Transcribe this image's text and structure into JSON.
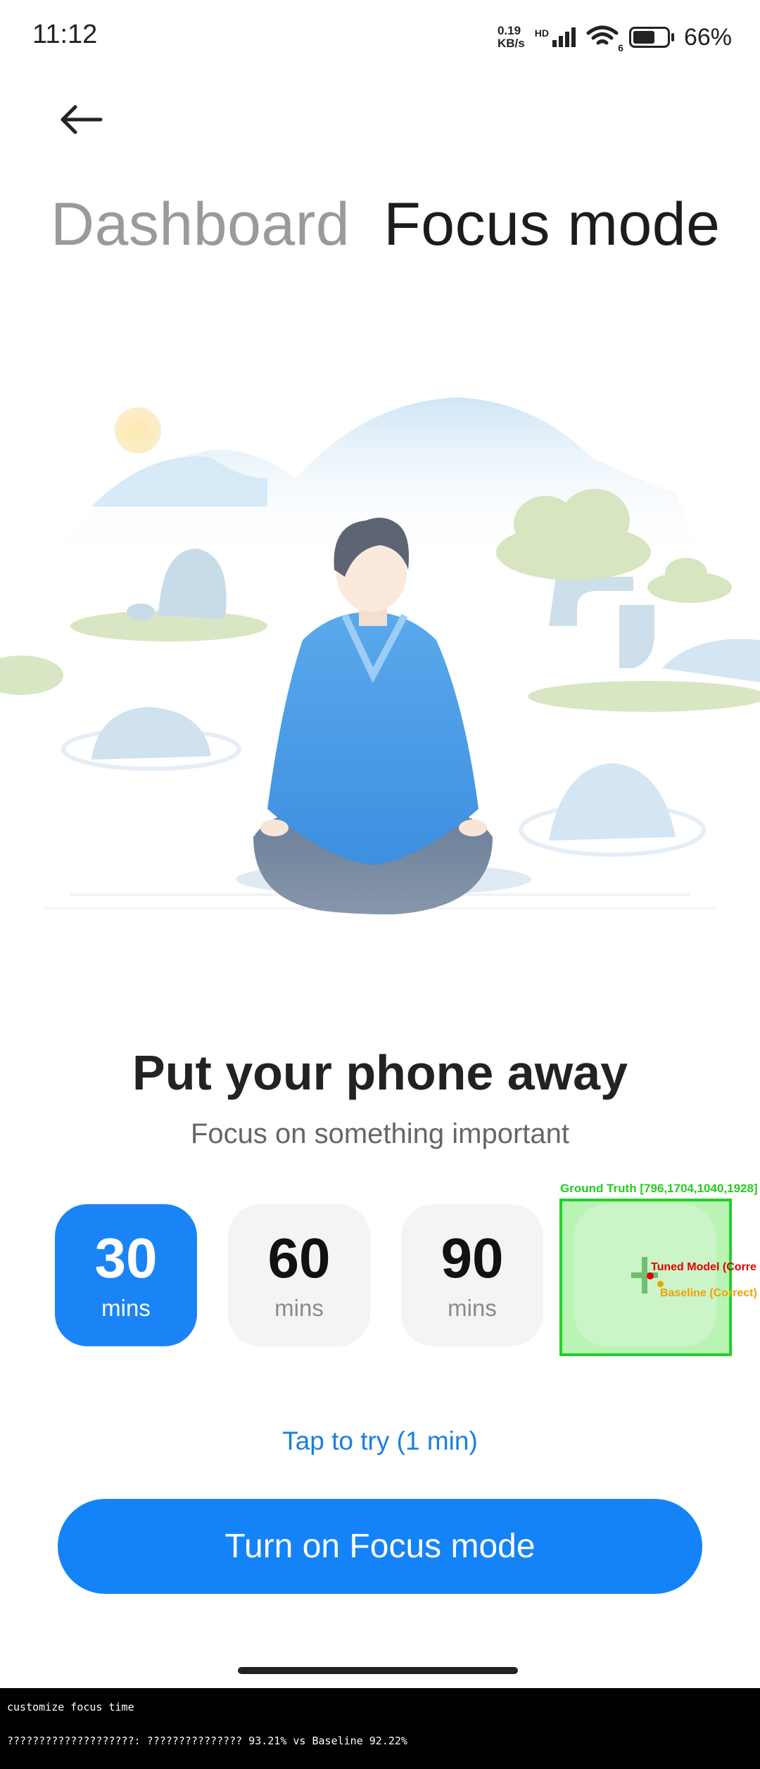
{
  "status_bar": {
    "time": "11:12",
    "net_speed_value": "0.19",
    "net_speed_unit": "KB/s",
    "signal_label": "HD",
    "wifi_label": "6",
    "battery_percent": "66%",
    "battery_level": 0.66
  },
  "tabs": [
    {
      "label": "Dashboard",
      "active": false
    },
    {
      "label": "Focus mode",
      "active": true
    }
  ],
  "illustration": {
    "icon": "meditation-illustration"
  },
  "content": {
    "headline": "Put your phone away",
    "subheadline": "Focus on something important"
  },
  "time_options": [
    {
      "value": "30",
      "unit": "mins",
      "selected": true
    },
    {
      "value": "60",
      "unit": "mins",
      "selected": false
    },
    {
      "value": "90",
      "unit": "mins",
      "selected": false
    },
    {
      "icon": "plus-icon",
      "label": "custom"
    }
  ],
  "overlay": {
    "ground_truth_label": "Ground Truth [796,1704,1040,1928]",
    "tuned_label": "Tuned Model (Corre",
    "baseline_label": "Baseline (Correct)"
  },
  "try_link": "Tap to try (1 min)",
  "cta_label": "Turn on Focus mode",
  "caption": {
    "instruction": "customize focus time",
    "result": "????????????????????: ??????????????? 93.21% vs Baseline 92.22%"
  },
  "colors": {
    "accent": "#1483f7",
    "selected_option": "#1a84f6",
    "ground_truth": "#22d02c",
    "tuned": "#e00000",
    "baseline": "#f2a000"
  }
}
